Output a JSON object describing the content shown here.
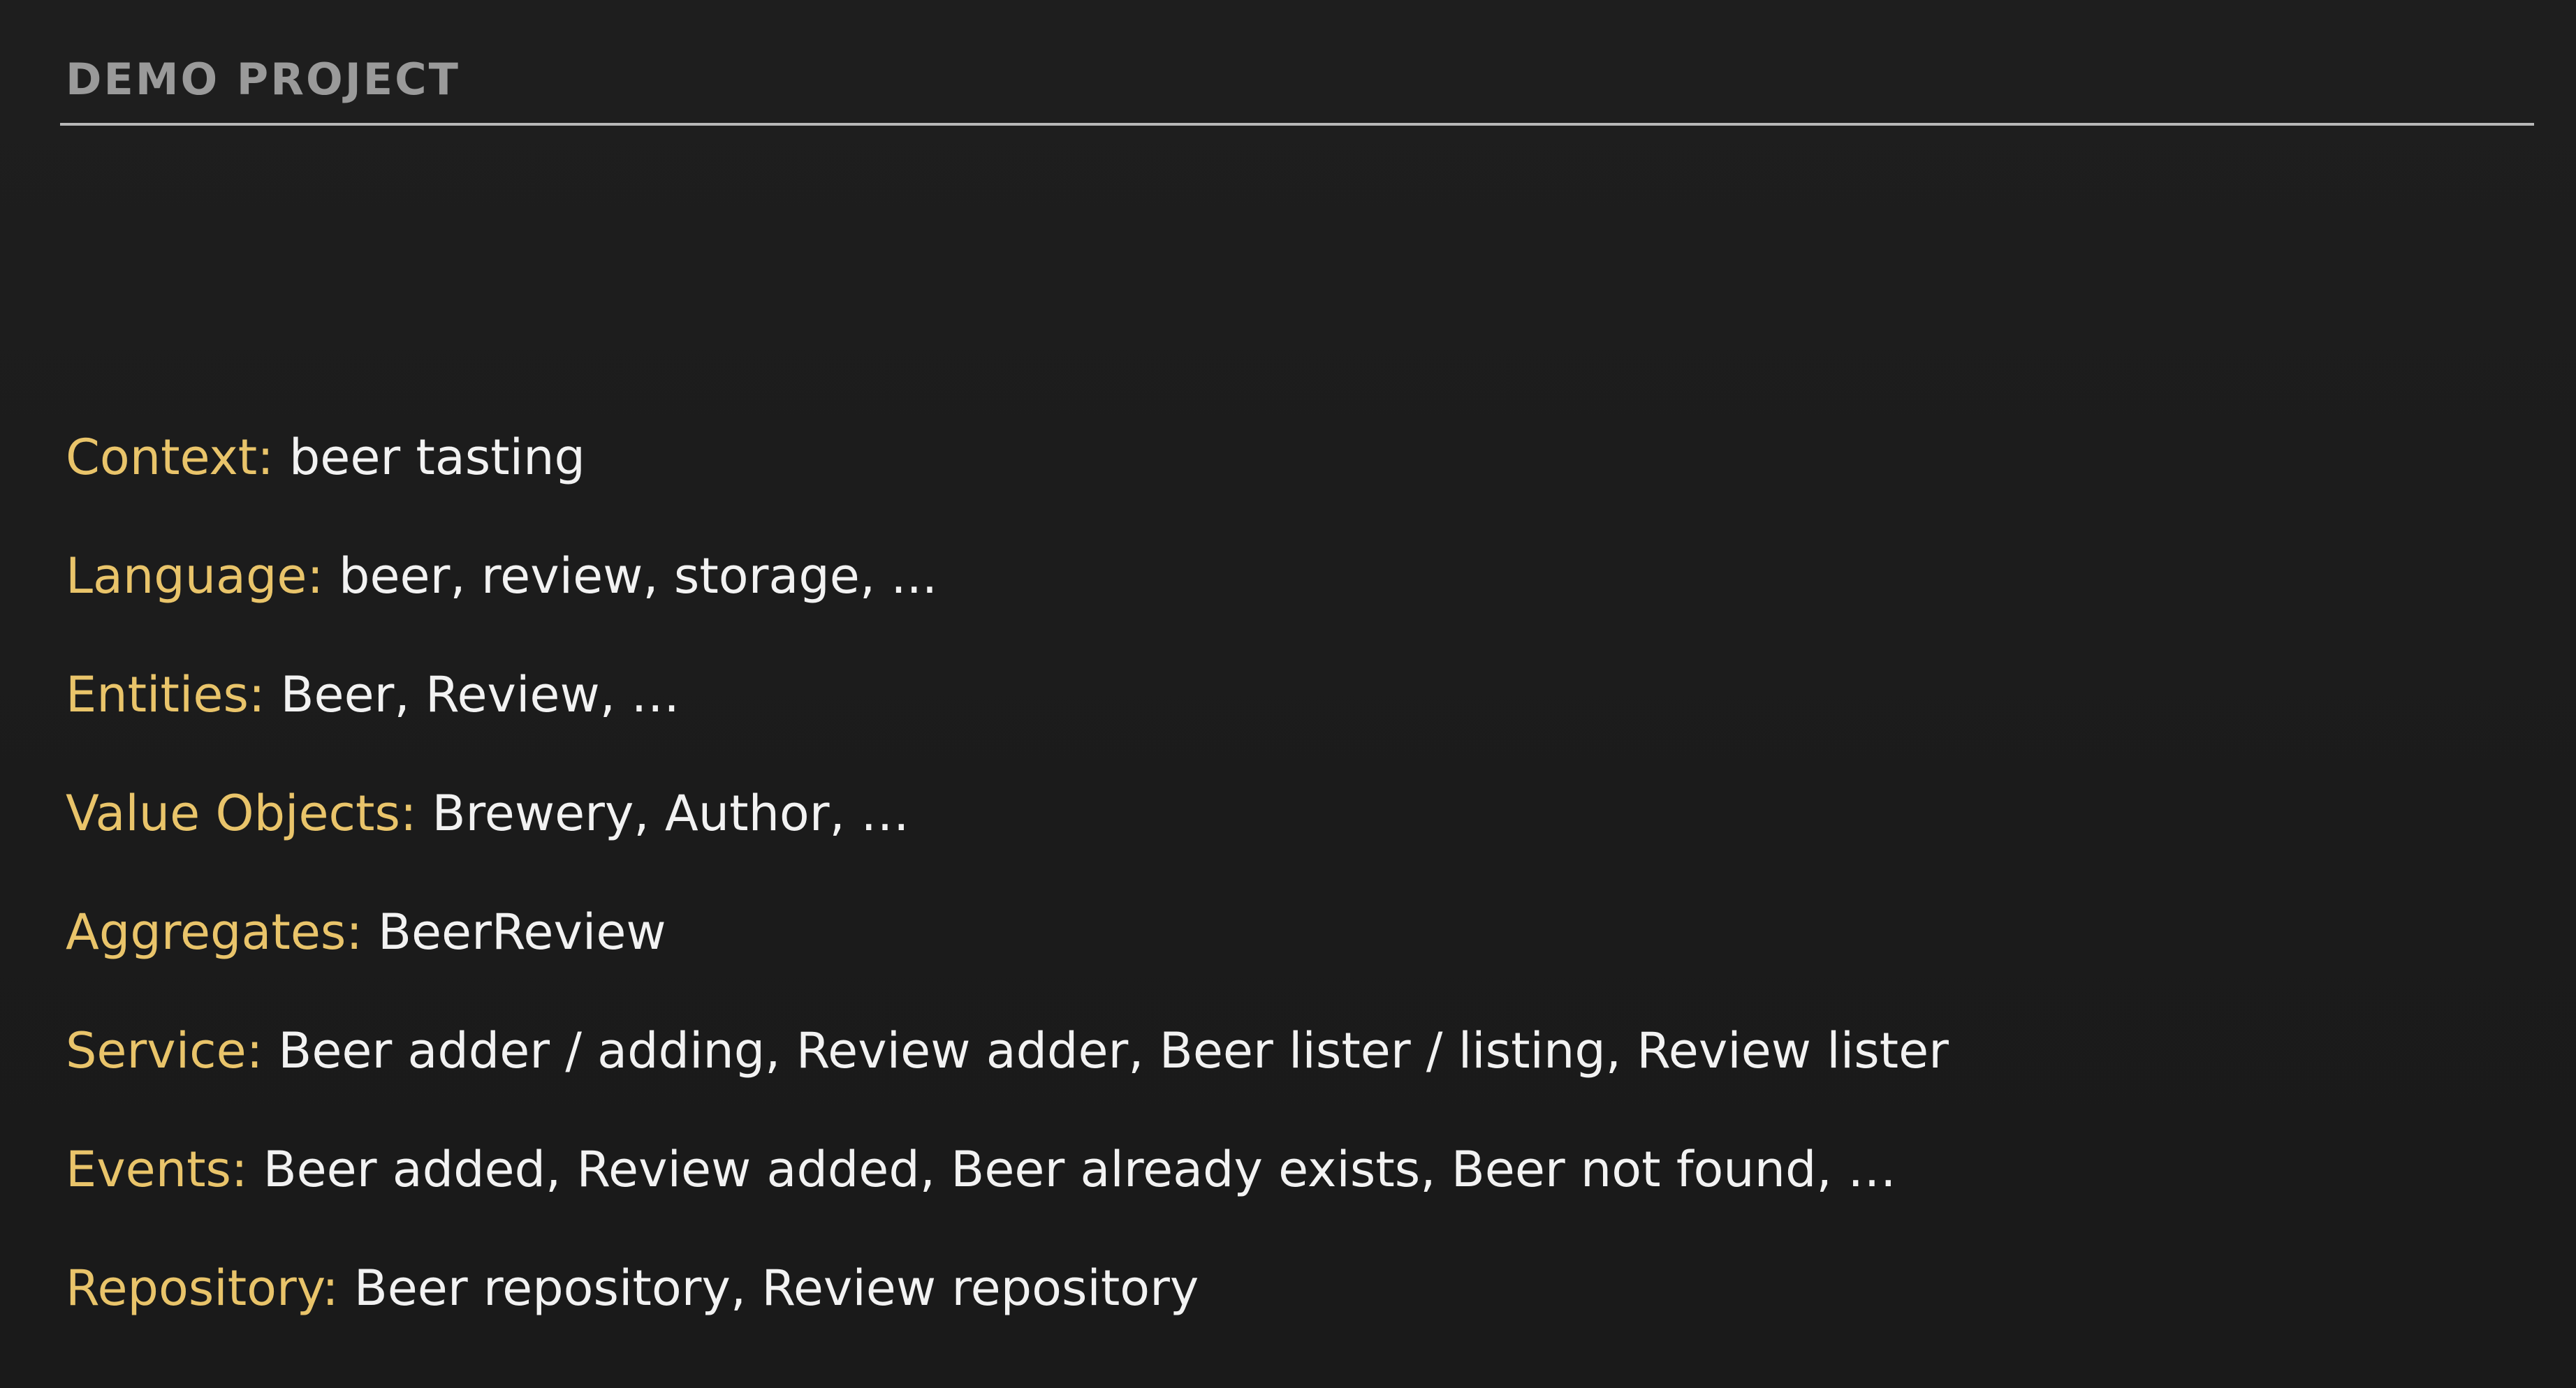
{
  "header": {
    "title": "DEMO PROJECT"
  },
  "colors": {
    "background": "#1c1c1c",
    "label": "#e9c46a",
    "value": "#f2f2f2",
    "header_text": "#9a9a9a",
    "rule": "#b8b8b8"
  },
  "rows": [
    {
      "label": "Context:",
      "value": "beer tasting"
    },
    {
      "label": "Language:",
      "value": "beer, review, storage, ..."
    },
    {
      "label": "Entities:",
      "value": "Beer, Review, …"
    },
    {
      "label": "Value Objects:",
      "value": "Brewery, Author, …"
    },
    {
      "label": "Aggregates:",
      "value": "BeerReview"
    },
    {
      "label": "Service:",
      "value": "Beer adder / adding, Review adder, Beer lister / listing, Review lister"
    },
    {
      "label": "Events:",
      "value": "Beer added, Review added, Beer already exists, Beer not found, …"
    },
    {
      "label": "Repository:",
      "value": "Beer repository, Review repository"
    }
  ]
}
